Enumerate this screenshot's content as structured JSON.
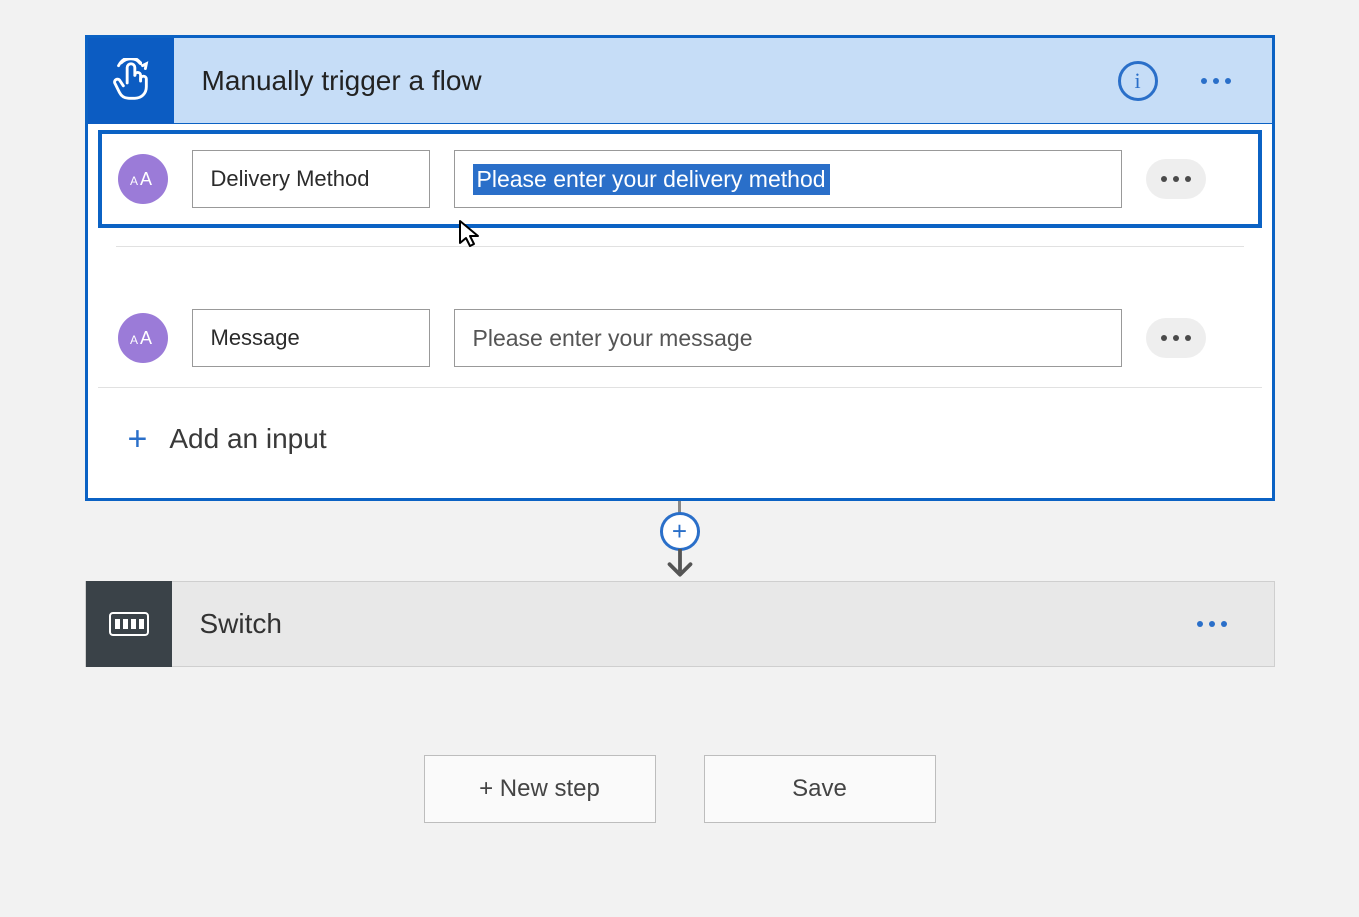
{
  "trigger": {
    "title": "Manually trigger a flow",
    "inputs": [
      {
        "type_icon": "text-icon",
        "name": "Delivery Method",
        "description": "Please enter your delivery method",
        "selected": true,
        "desc_selected": true
      },
      {
        "type_icon": "text-icon",
        "name": "Message",
        "description": "Please enter your message",
        "selected": false,
        "desc_selected": false
      }
    ],
    "add_input_label": "Add an input"
  },
  "switch": {
    "title": "Switch"
  },
  "buttons": {
    "new_step": "+ New step",
    "save": "Save"
  }
}
